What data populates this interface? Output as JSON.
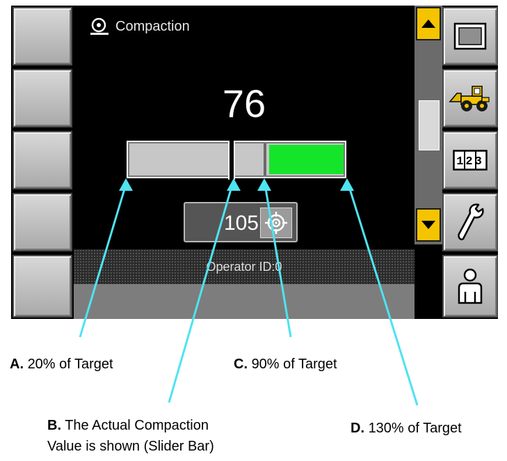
{
  "screen": {
    "title": "Compaction",
    "actual_value": "76",
    "target_value": "105",
    "operator_id": "Operator ID:0",
    "bar": {
      "min_percent_of_target": 20,
      "green_start_percent_of_target": 90,
      "max_percent_of_target": 130,
      "actual_value": 76,
      "target_value": 105
    },
    "right_softkeys": [
      "display-icon",
      "machine-icon",
      "counter-icon",
      "wrench-icon",
      "operator-icon"
    ],
    "counter_label": "123",
    "colors": {
      "green_zone": "#15e52a",
      "scroll_buttons": "#f5c400",
      "annotation_lines": "#4fe3f0"
    }
  },
  "annotations": {
    "a": {
      "letter": "A.",
      "text": "20% of Target"
    },
    "b": {
      "letter": "B.",
      "text_line1": "The Actual Compaction",
      "text_line2": "Value is shown (Slider Bar)"
    },
    "c": {
      "letter": "C.",
      "text": "90% of Target"
    },
    "d": {
      "letter": "D.",
      "text": "130% of Target"
    }
  }
}
